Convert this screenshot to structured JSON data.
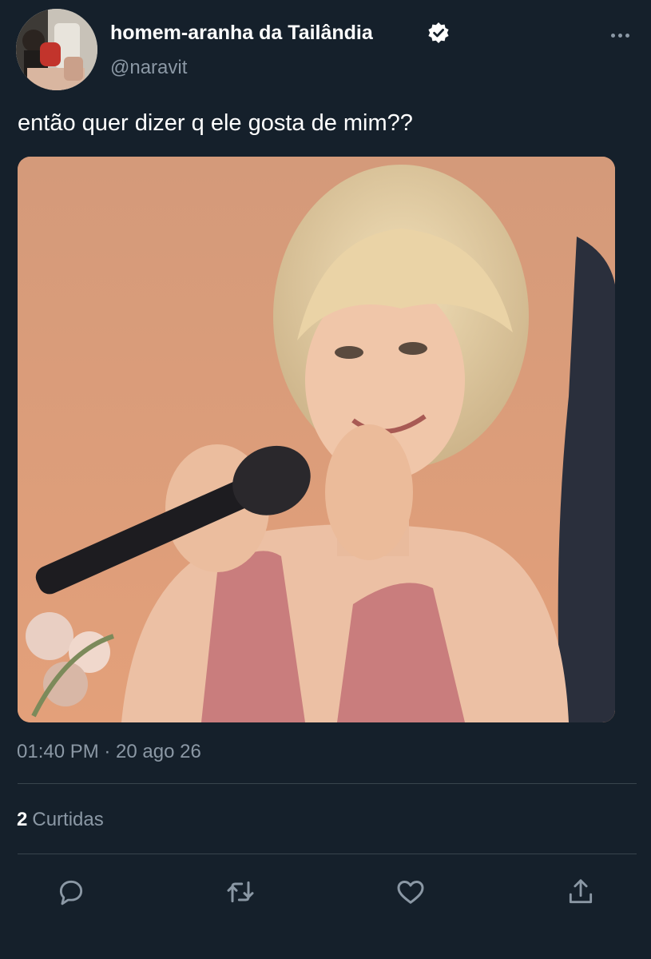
{
  "header": {
    "display_name": "homem-aranha da Tailândia",
    "handle": "@naravit",
    "verified": true,
    "avatar_icon": "profile-photo-mirror-selfie",
    "more_icon": "more-horizontal-icon"
  },
  "tweet": {
    "text": "então quer dizer q ele gosta de mim??",
    "media_icon": "photo-woman-blonde-with-microphone",
    "timestamp": "01:40 PM · 20 ago 26"
  },
  "stats": {
    "likes_count": "2",
    "likes_label": "Curtidas"
  },
  "actions": [
    {
      "icon": "reply-icon"
    },
    {
      "icon": "retweet-icon"
    },
    {
      "icon": "like-icon"
    },
    {
      "icon": "share-icon"
    }
  ],
  "colors": {
    "background": "#15202b",
    "primary_text": "#ffffff",
    "secondary_text": "#8b98a5",
    "divider": "#38444d"
  }
}
